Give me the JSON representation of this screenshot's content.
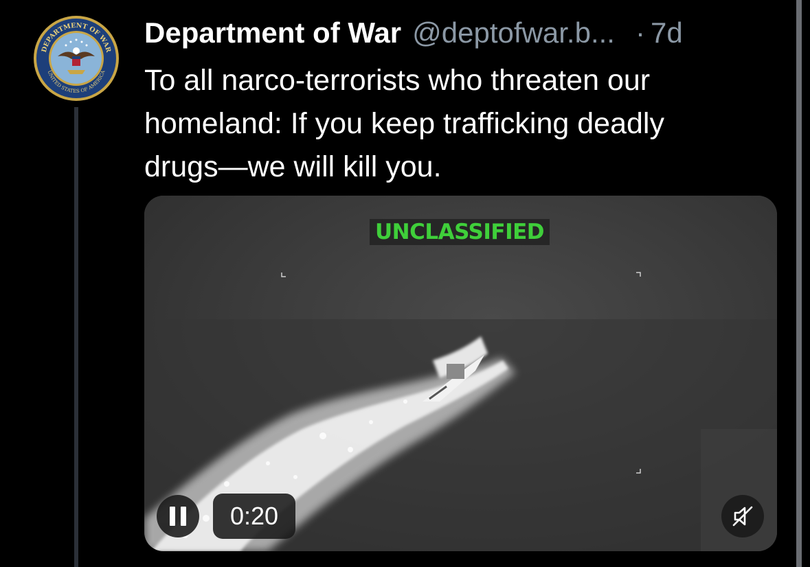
{
  "post": {
    "author": {
      "display_name": "Department of War",
      "handle": "@deptofwar.b...",
      "avatar_icon": "department-of-war-seal",
      "seal_top_text": "DEPARTMENT OF WAR",
      "seal_bottom_text": "UNITED STATES OF AMERICA"
    },
    "separator": "·",
    "age": "7d",
    "text": "To all narco-terrorists who threaten our\nhomeland: If you keep trafficking deadly\ndrugs—we will kill you.",
    "video": {
      "overlay_label": "UNCLASSIFIED",
      "elapsed": "0:20",
      "playing": true,
      "muted": true,
      "pause_icon": "pause-icon",
      "mute_icon": "muted-speaker-icon"
    }
  },
  "colors": {
    "background": "#000000",
    "secondary_text": "#8b98a5",
    "thread_line": "#2b3038",
    "label_green": "#3fcf3a"
  }
}
